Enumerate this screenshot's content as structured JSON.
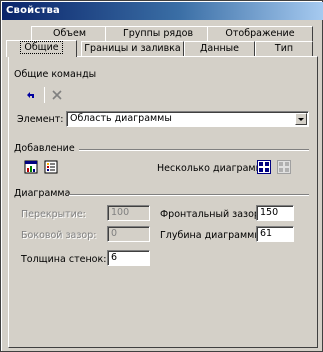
{
  "window": {
    "title": "Свойства"
  },
  "tabs_back": [
    {
      "label": "Объем"
    },
    {
      "label": "Группы рядов"
    },
    {
      "label": "Отображение"
    }
  ],
  "tabs_front": [
    {
      "label": "Общие"
    },
    {
      "label": "Границы и заливка"
    },
    {
      "label": "Данные"
    },
    {
      "label": "Тип"
    }
  ],
  "general_commands": {
    "title": "Общие команды",
    "element_label": "Элемент:",
    "element_value": "Область диаграммы"
  },
  "add": {
    "title": "Добавление",
    "multiple_charts_label": "Несколько диаграмм"
  },
  "chart": {
    "title": "Диаграмма",
    "overlap_label": "Перекрытие:",
    "overlap_value": "100",
    "side_gap_label": "Боковой зазор:",
    "side_gap_value": "0",
    "wall_thickness_label": "Толщина стенок:",
    "wall_thickness_value": "6",
    "front_gap_label": "Фронтальный зазор:",
    "front_gap_value": "150",
    "chart_depth_label": "Глубина диаграммы:",
    "chart_depth_value": "61"
  },
  "colors": {
    "title_start": "#0a246a",
    "title_end": "#a6caf0",
    "face": "#d4d0c8"
  }
}
